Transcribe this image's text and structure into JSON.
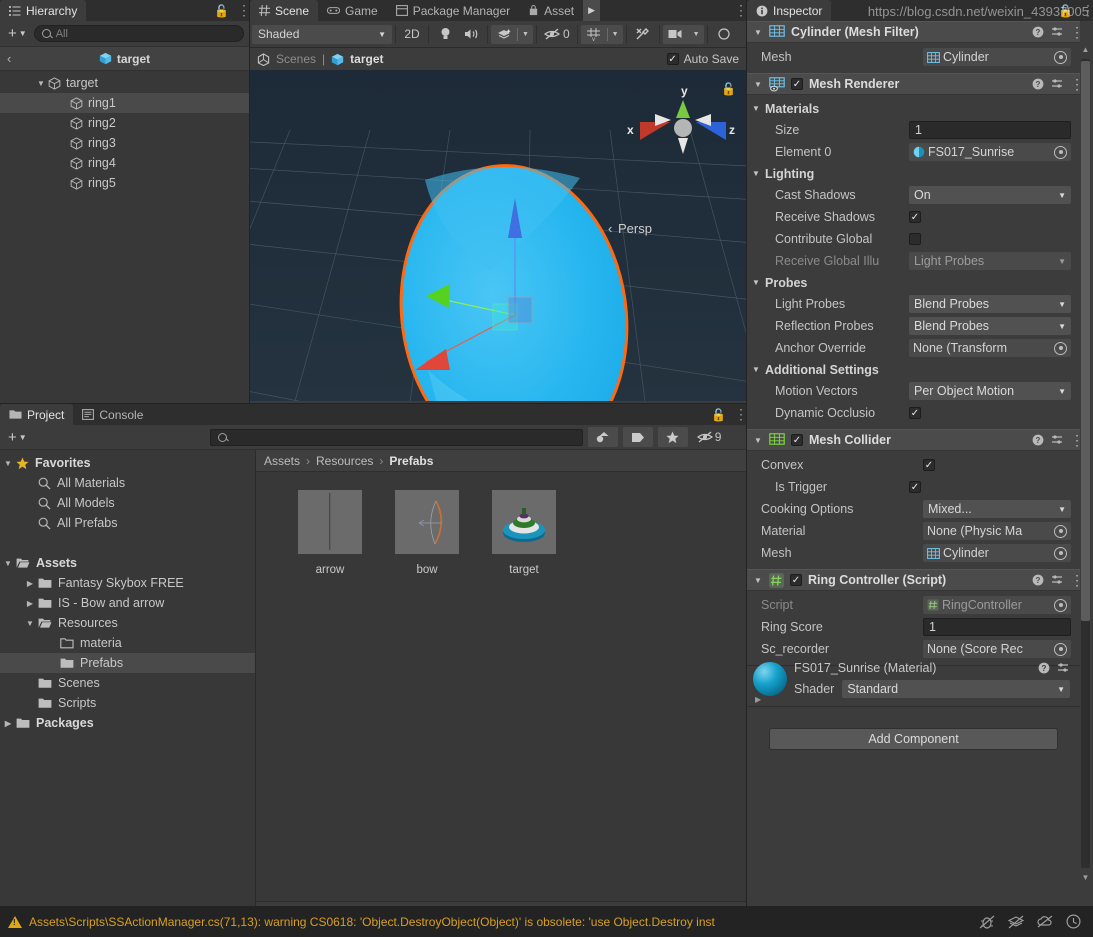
{
  "hierarchy": {
    "tab_label": "Hierarchy",
    "search_placeholder": "All",
    "breadcrumb_label": "target",
    "items": [
      {
        "label": "target",
        "indent": 0,
        "expanded": true,
        "selected": false
      },
      {
        "label": "ring1",
        "indent": 1,
        "expanded": false,
        "selected": true
      },
      {
        "label": "ring2",
        "indent": 1,
        "expanded": false,
        "selected": false
      },
      {
        "label": "ring3",
        "indent": 1,
        "expanded": false,
        "selected": false
      },
      {
        "label": "ring4",
        "indent": 1,
        "expanded": false,
        "selected": false
      },
      {
        "label": "ring5",
        "indent": 1,
        "expanded": false,
        "selected": false
      }
    ]
  },
  "scene": {
    "tabs": [
      {
        "label": "Scene",
        "icon": "grid-icon",
        "active": true
      },
      {
        "label": "Game",
        "icon": "gamepad-icon",
        "active": false
      },
      {
        "label": "Package Manager",
        "icon": "package-icon",
        "active": false
      },
      {
        "label": "Asset",
        "icon": "store-icon",
        "active": false
      }
    ],
    "draw_mode": "Shaded",
    "toggle_2d": "2D",
    "hidden_count": "0",
    "breadcrumb_scenes": "Scenes",
    "breadcrumb_object": "target",
    "auto_save_label": "Auto Save",
    "auto_save_checked": true,
    "gizmo": {
      "axis_y": "y",
      "axis_x": "x",
      "axis_z": "z",
      "projection": "Persp"
    }
  },
  "project": {
    "tabs": [
      {
        "label": "Project",
        "icon": "folder-icon",
        "active": true
      },
      {
        "label": "Console",
        "icon": "console-icon",
        "active": false
      }
    ],
    "search_value": "",
    "hidden_count": "9",
    "breadcrumbs": [
      "Assets",
      "Resources",
      "Prefabs"
    ],
    "tree": [
      {
        "label": "Favorites",
        "indent": 0,
        "arrow": "down",
        "icon": "star-icon",
        "bold": true,
        "selected": false
      },
      {
        "label": "All Materials",
        "indent": 1,
        "arrow": "",
        "icon": "search-icon",
        "bold": false,
        "selected": false
      },
      {
        "label": "All Models",
        "indent": 1,
        "arrow": "",
        "icon": "search-icon",
        "bold": false,
        "selected": false
      },
      {
        "label": "All Prefabs",
        "indent": 1,
        "arrow": "",
        "icon": "search-icon",
        "bold": false,
        "selected": false
      },
      {
        "label": "",
        "indent": 0,
        "arrow": "",
        "icon": "",
        "bold": false,
        "selected": false
      },
      {
        "label": "Assets",
        "indent": 0,
        "arrow": "down",
        "icon": "folder-open-icon",
        "bold": true,
        "selected": false
      },
      {
        "label": "Fantasy Skybox FREE",
        "indent": 1,
        "arrow": "right",
        "icon": "folder-icon",
        "bold": false,
        "selected": false
      },
      {
        "label": "IS - Bow and arrow",
        "indent": 1,
        "arrow": "right",
        "icon": "folder-icon",
        "bold": false,
        "selected": false
      },
      {
        "label": "Resources",
        "indent": 1,
        "arrow": "down",
        "icon": "folder-open-icon",
        "bold": false,
        "selected": false
      },
      {
        "label": "materia",
        "indent": 2,
        "arrow": "",
        "icon": "folder-empty-icon",
        "bold": false,
        "selected": false
      },
      {
        "label": "Prefabs",
        "indent": 2,
        "arrow": "",
        "icon": "folder-icon",
        "bold": false,
        "selected": true
      },
      {
        "label": "Scenes",
        "indent": 1,
        "arrow": "",
        "icon": "folder-icon",
        "bold": false,
        "selected": false
      },
      {
        "label": "Scripts",
        "indent": 1,
        "arrow": "",
        "icon": "folder-icon",
        "bold": false,
        "selected": false
      },
      {
        "label": "Packages",
        "indent": 0,
        "arrow": "right",
        "icon": "folder-icon",
        "bold": true,
        "selected": false
      }
    ],
    "assets": [
      {
        "name": "arrow",
        "kind": "arrow-thumb"
      },
      {
        "name": "bow",
        "kind": "bow-thumb"
      },
      {
        "name": "target",
        "kind": "target-thumb"
      }
    ]
  },
  "inspector": {
    "tab_label": "Inspector",
    "components": [
      {
        "title": "Cylinder (Mesh Filter)",
        "icon": "mesh-filter-icon",
        "has_checkbox": false,
        "enabled": false,
        "rows": [
          {
            "type": "object",
            "label": "Mesh",
            "value": "Cylinder",
            "icon": "mesh-icon",
            "indent": 0,
            "dim": false
          }
        ]
      },
      {
        "title": "Mesh Renderer",
        "icon": "mesh-renderer-icon",
        "has_checkbox": true,
        "enabled": true,
        "rows": [
          {
            "type": "section",
            "label": "Materials"
          },
          {
            "type": "text",
            "label": "Size",
            "value": "1",
            "indent": 1,
            "dim": false
          },
          {
            "type": "object",
            "label": "Element 0",
            "value": "FS017_Sunrise",
            "icon": "material-icon",
            "indent": 1,
            "dim": false
          },
          {
            "type": "section",
            "label": "Lighting"
          },
          {
            "type": "dropdown",
            "label": "Cast Shadows",
            "value": "On",
            "indent": 1,
            "dim": false
          },
          {
            "type": "checkbox",
            "label": "Receive Shadows",
            "checked": true,
            "indent": 1,
            "dim": false
          },
          {
            "type": "checkbox",
            "label": "Contribute Global",
            "checked": false,
            "indent": 1,
            "dim": false
          },
          {
            "type": "dropdown",
            "label": "Receive Global Illu",
            "value": "Light Probes",
            "indent": 1,
            "dim": true
          },
          {
            "type": "section",
            "label": "Probes"
          },
          {
            "type": "dropdown",
            "label": "Light Probes",
            "value": "Blend Probes",
            "indent": 1,
            "dim": false
          },
          {
            "type": "dropdown",
            "label": "Reflection Probes",
            "value": "Blend Probes",
            "indent": 1,
            "dim": false
          },
          {
            "type": "object",
            "label": "Anchor Override",
            "value": "None (Transform",
            "icon": "",
            "indent": 1,
            "dim": false
          },
          {
            "type": "section",
            "label": "Additional Settings"
          },
          {
            "type": "dropdown",
            "label": "Motion Vectors",
            "value": "Per Object Motion",
            "indent": 1,
            "dim": false
          },
          {
            "type": "checkbox",
            "label": "Dynamic Occlusio",
            "checked": true,
            "indent": 1,
            "dim": false
          }
        ]
      },
      {
        "title": "Mesh Collider",
        "icon": "mesh-collider-icon",
        "has_checkbox": true,
        "enabled": true,
        "rows": [
          {
            "type": "checkbox",
            "label": "Convex",
            "checked": true,
            "indent": 0,
            "dim": false
          },
          {
            "type": "checkbox",
            "label": "Is Trigger",
            "checked": true,
            "indent": 1,
            "dim": false
          },
          {
            "type": "dropdown",
            "label": "Cooking Options",
            "value": "Mixed...",
            "indent": 0,
            "dim": false
          },
          {
            "type": "object",
            "label": "Material",
            "value": "None (Physic Ma",
            "icon": "",
            "indent": 0,
            "dim": false
          },
          {
            "type": "object",
            "label": "Mesh",
            "value": "Cylinder",
            "icon": "mesh-icon",
            "indent": 0,
            "dim": false
          }
        ]
      },
      {
        "title": "Ring Controller (Script)",
        "icon": "script-icon",
        "has_checkbox": true,
        "enabled": true,
        "rows": [
          {
            "type": "object",
            "label": "Script",
            "value": "RingController",
            "icon": "script-small-icon",
            "indent": 0,
            "dim": true
          },
          {
            "type": "text",
            "label": "Ring Score",
            "value": "1",
            "indent": 0,
            "dim": false
          },
          {
            "type": "object",
            "label": "Sc_recorder",
            "value": "None (Score Rec",
            "icon": "",
            "indent": 0,
            "dim": false
          }
        ]
      }
    ],
    "material_preview": {
      "title": "FS017_Sunrise (Material)",
      "shader_label": "Shader",
      "shader_value": "Standard"
    },
    "add_component_label": "Add Component"
  },
  "status_bar": {
    "message": "Assets\\Scripts\\SSActionManager.cs(71,13): warning CS0618: 'Object.DestroyObject(Object)' is obsolete: 'use Object.Destroy inst",
    "watermark": "https://blog.csdn.net/weixin_43937005"
  },
  "colors": {
    "accent_blue": "#3ab4e8",
    "selection_orange": "#ff6a10",
    "warning": "#d8a01a",
    "panel": "#3c3c3c",
    "panel_dark": "#2e2e2e",
    "selected_row": "#4a4a4a"
  }
}
